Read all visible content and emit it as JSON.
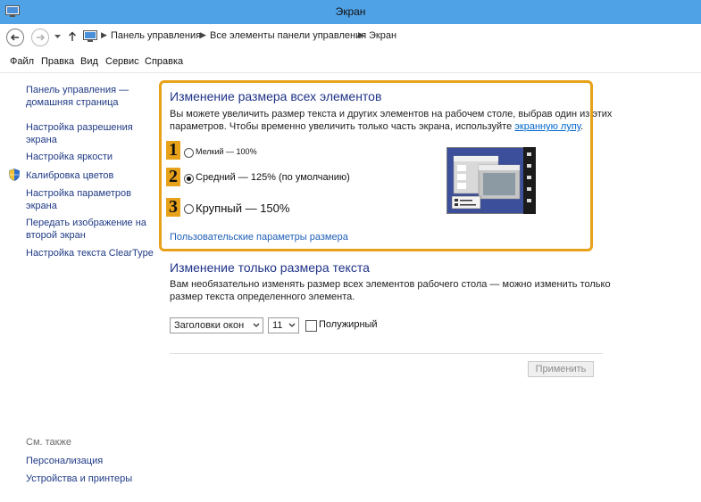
{
  "window": {
    "title": "Экран"
  },
  "address": {
    "crumbs": [
      "Панель управления",
      "Все элементы панели управления",
      "Экран"
    ]
  },
  "menu": [
    "Файл",
    "Правка",
    "Вид",
    "Сервис",
    "Справка"
  ],
  "sidebar": {
    "items": [
      "Панель управления —",
      "домашняя страница",
      "Настройка разрешения",
      "экрана",
      "Настройка яркости",
      "Калибровка цветов",
      "Настройка параметров",
      "экрана",
      "Передать изображение на",
      "второй экран",
      "Настройка текста ClearType"
    ],
    "see_also": "См. также",
    "see_also_links": [
      "Персонализация",
      "Устройства и принтеры"
    ]
  },
  "section1": {
    "heading": "Изменение размера всех элементов",
    "desc_line1": "Вы можете увеличить размер текста и других элементов на рабочем столе, выбрав один из этих",
    "desc_line2_prefix": "параметров. Чтобы временно увеличить только часть экрана, используйте ",
    "desc_link": "экранную лупу",
    "desc_suffix": ".",
    "options": [
      {
        "badge": "1",
        "label": "Мелкий — 100%",
        "checked": false
      },
      {
        "badge": "2",
        "label": "Средний — 125% (по умолчанию)",
        "checked": true
      },
      {
        "badge": "3",
        "label": "Крупный — 150%",
        "checked": false
      }
    ],
    "custom_link": "Пользовательские параметры размера"
  },
  "section2": {
    "heading": "Изменение только размера текста",
    "desc_line1": "Вам необязательно изменять размер всех элементов рабочего стола — можно изменить только",
    "desc_line2": "размер текста определенного элемента.",
    "element_select": "Заголовки окон",
    "size_select": "11",
    "bold_label": "Полужирный",
    "apply_label": "Применить"
  },
  "colors": {
    "titlebar": "#50a2e6",
    "highlight": "#e8a21a",
    "heading": "#1e3287",
    "link": "#1f3a85"
  }
}
